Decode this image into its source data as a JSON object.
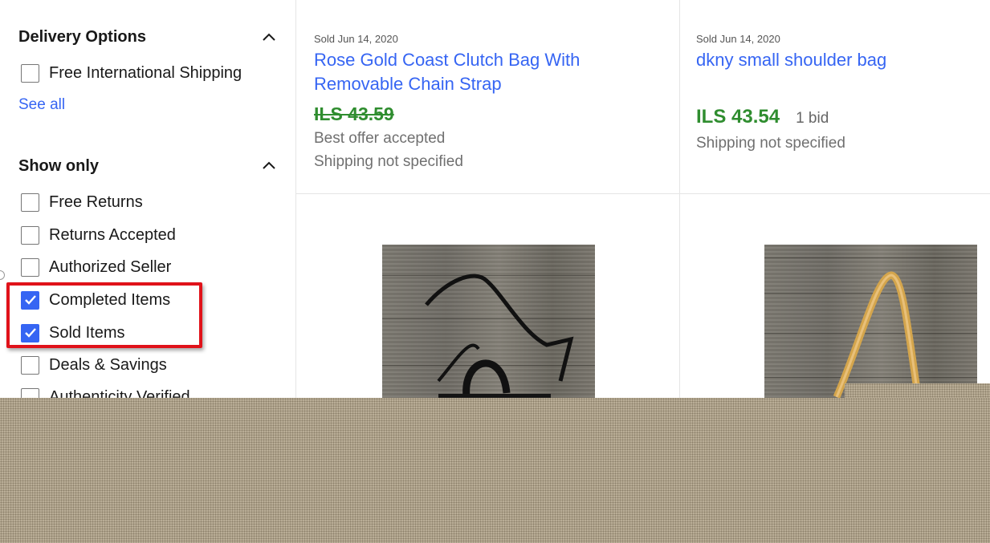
{
  "filters": {
    "delivery": {
      "title": "Delivery Options",
      "options": [
        {
          "label": "Free International Shipping",
          "checked": false
        }
      ],
      "see_all": "See all"
    },
    "show_only": {
      "title": "Show only",
      "options": [
        {
          "label": "Free Returns",
          "checked": false
        },
        {
          "label": "Returns Accepted",
          "checked": false
        },
        {
          "label": "Authorized Seller",
          "checked": false
        },
        {
          "label": "Completed Items",
          "checked": true
        },
        {
          "label": "Sold Items",
          "checked": true
        },
        {
          "label": "Deals & Savings",
          "checked": false
        },
        {
          "label": "Authenticity Verified",
          "checked": false
        }
      ]
    }
  },
  "listings": [
    {
      "sold_date": "Sold Jun 14, 2020",
      "title_line1": "Rose Gold Coast Clutch Bag With",
      "title_line2": "Removable Chain Strap",
      "price": "ILS 43.59",
      "price_struck": true,
      "offer": "Best offer accepted",
      "shipping": "Shipping not specified"
    },
    {
      "sold_date": "Sold Jun 14, 2020",
      "title_line1": "dkny small shoulder bag",
      "price": "ILS 43.54",
      "bids": "1 bid",
      "shipping": "Shipping not specified"
    }
  ],
  "colors": {
    "link": "#3665f3",
    "price": "#2f8d2f",
    "highlight": "#e0121a",
    "checkbox_checked": "#3665f3"
  }
}
